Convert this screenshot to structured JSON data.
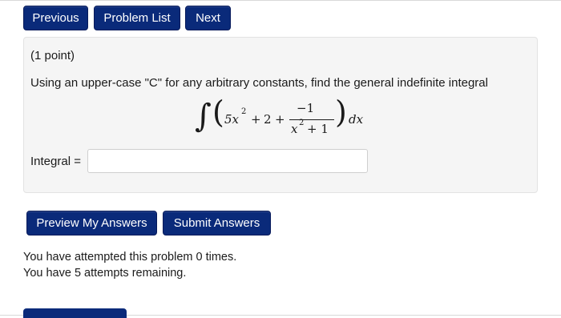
{
  "nav": {
    "previous_label": "Previous",
    "problem_list_label": "Problem List",
    "next_label": "Next"
  },
  "problem": {
    "points": "(1 point)",
    "prompt": "Using an upper-case \"C\" for any arbitrary constants, find the general indefinite integral",
    "integral": {
      "integral_sign": "∫",
      "left_paren": "(",
      "term1_coef_var": "5x",
      "term1_exp": "2",
      "plus1": "+",
      "term2": "2",
      "plus2": "+",
      "numerator": "−1",
      "denominator_var": "x",
      "denominator_exp": "2",
      "denominator_rest": "+ 1",
      "right_paren": ")",
      "differential": "dx"
    },
    "answer_label": "Integral =",
    "answer_value": ""
  },
  "actions": {
    "preview_label": "Preview My Answers",
    "submit_label": "Submit Answers"
  },
  "status": {
    "attempted": "You have attempted this problem 0 times.",
    "remaining": "You have 5 attempts remaining."
  },
  "colors": {
    "button_bg": "#0a2a7a",
    "panel_bg": "#f5f5f5"
  }
}
